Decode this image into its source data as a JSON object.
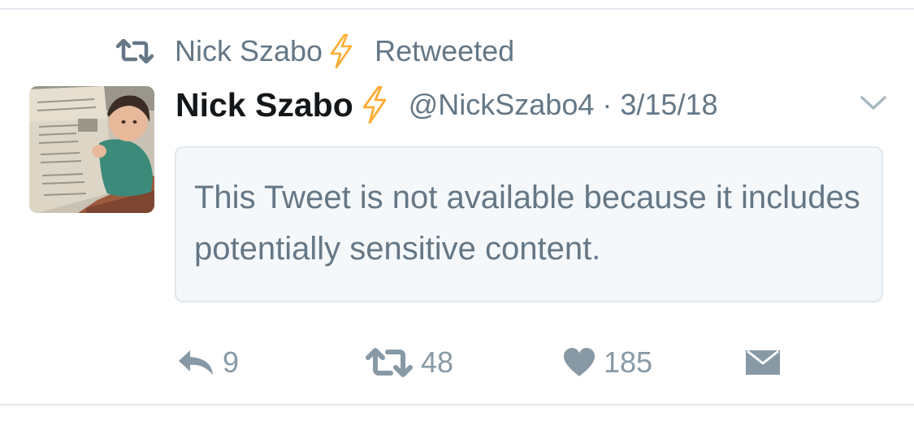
{
  "context": {
    "retweeter_name": "Nick Szabo",
    "retweeted_label": "Retweeted"
  },
  "tweet": {
    "author_name": "Nick Szabo",
    "handle": "@NickSzabo4",
    "separator": "·",
    "date": "3/15/18",
    "notice": "This Tweet is not available because it includes potentially sensitive content."
  },
  "actions": {
    "reply_count": "9",
    "retweet_count": "48",
    "like_count": "185"
  },
  "icons": {
    "retweet_context": "retweet-icon",
    "name_badge": "lightning-bolt-icon",
    "menu": "chevron-down-icon",
    "reply": "reply-icon",
    "retweet": "retweet-icon",
    "like": "heart-icon",
    "dm": "envelope-icon"
  },
  "colors": {
    "secondary_text": "#657786",
    "action_icons": "#8899a6",
    "bolt": "#ffac33",
    "notice_background": "#f5f8fa",
    "border": "#e1e8ed"
  }
}
